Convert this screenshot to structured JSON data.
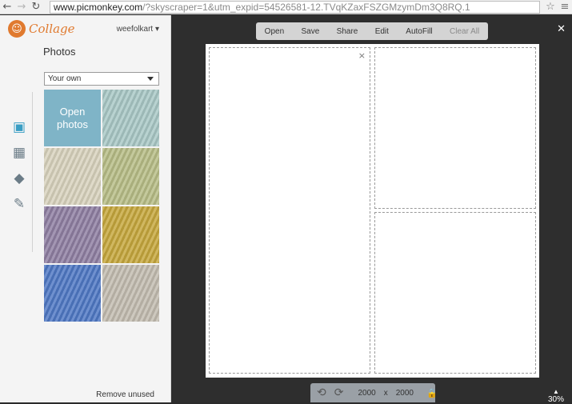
{
  "browser": {
    "back": "←",
    "forward": "→",
    "reload": "↻",
    "url_host": "www.picmonkey.com",
    "url_rest": "/?skyscraper=1&utm_expid=54526581-12.TVqKZaxFSZGMzymDm3Q8RQ.1",
    "star": "☆",
    "menu": "≡"
  },
  "sidebar": {
    "logo_text": "Collage",
    "user": "weefolkart ▾",
    "title": "Photos",
    "dropdown_value": "Your own",
    "open_photos": "Open photos",
    "remove_unused": "Remove unused",
    "tools": [
      {
        "icon": "photos-icon",
        "glyph": "▣"
      },
      {
        "icon": "layouts-icon",
        "glyph": "▦"
      },
      {
        "icon": "stickers-icon",
        "glyph": "◆"
      },
      {
        "icon": "palette-icon",
        "glyph": "✎"
      }
    ],
    "yarn_colors": [
      "#a9c8c6",
      "#d8d2bd",
      "#b7bd86",
      "#8f7fa2",
      "#c6a73d",
      "#4f78c4",
      "#c2bcb0"
    ]
  },
  "toolbar": {
    "open": "Open",
    "save": "Save",
    "share": "Share",
    "edit": "Edit",
    "autofill": "AutoFill",
    "clear_all": "Clear All"
  },
  "canvas": {
    "close": "✕",
    "cell_close": "×",
    "width": "2000",
    "times": "x",
    "height": "2000",
    "zoom": "30%",
    "zoom_arrow": "▲"
  }
}
